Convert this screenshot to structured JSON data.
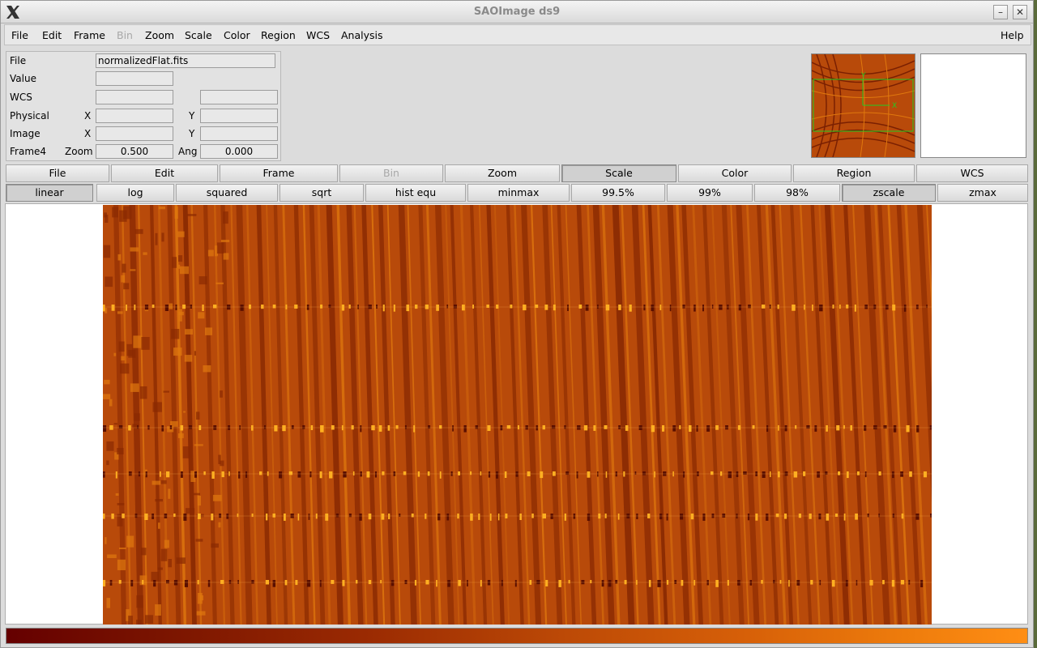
{
  "window": {
    "title": "SAOImage ds9",
    "minimize_glyph": "–",
    "close_glyph": "✕"
  },
  "menubar": {
    "items": [
      "File",
      "Edit",
      "Frame",
      "Bin",
      "Zoom",
      "Scale",
      "Color",
      "Region",
      "WCS",
      "Analysis"
    ],
    "disabled": [
      "Bin"
    ],
    "help": "Help"
  },
  "info": {
    "file_label": "File",
    "file_value": "normalizedFlat.fits",
    "value_label": "Value",
    "value": "",
    "wcs_label": "WCS",
    "wcs_a": "",
    "wcs_b": "",
    "physical_label": "Physical",
    "physical_x_label": "X",
    "physical_x": "",
    "physical_y_label": "Y",
    "physical_y": "",
    "image_label": "Image",
    "image_x_label": "X",
    "image_x": "",
    "image_y_label": "Y",
    "image_y": "",
    "frame_label": "Frame4",
    "zoom_label": "Zoom",
    "zoom": "0.500",
    "angle_label": "Ang",
    "angle": "0.000"
  },
  "panner": {
    "x_axis": "X",
    "y_axis": "Y"
  },
  "buttonbar": {
    "items": [
      "File",
      "Edit",
      "Frame",
      "Bin",
      "Zoom",
      "Scale",
      "Color",
      "Region",
      "WCS"
    ],
    "active": "Scale",
    "disabled": [
      "Bin"
    ]
  },
  "scalebar": {
    "items": [
      "linear",
      "log",
      "squared",
      "sqrt",
      "hist equ",
      "minmax",
      "99.5%",
      "99%",
      "98%",
      "zscale",
      "zmax"
    ],
    "active": [
      "linear",
      "zscale"
    ]
  },
  "colors": {
    "image_base": "#b84a0a",
    "stripe_dark": "#8a2a02",
    "stripe_light": "#e0780e",
    "panner_cursor": "#22cc22"
  }
}
